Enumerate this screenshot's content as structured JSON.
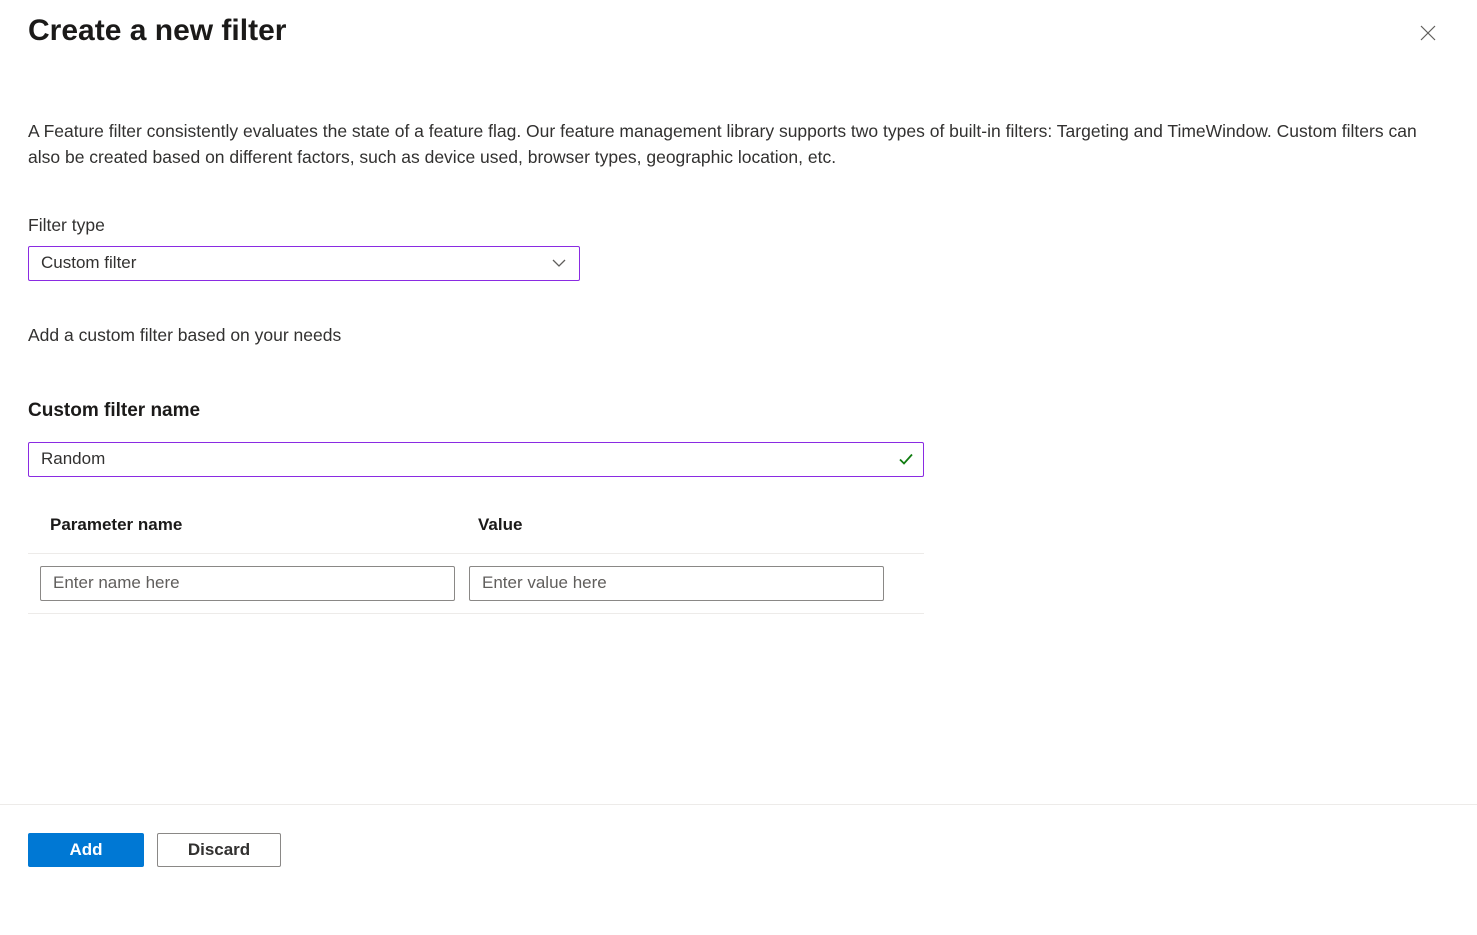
{
  "header": {
    "title": "Create a new filter"
  },
  "description": "A Feature filter consistently evaluates the state of a feature flag. Our feature management library supports two types of built-in filters: Targeting and TimeWindow. Custom filters can also be created based on different factors, such as device used, browser types, geographic location, etc.",
  "filter_type": {
    "label": "Filter type",
    "selected": "Custom filter"
  },
  "helper_text": "Add a custom filter based on your needs",
  "custom_name": {
    "label": "Custom filter name",
    "value": "Random"
  },
  "params": {
    "header_name": "Parameter name",
    "header_value": "Value",
    "rows": [
      {
        "name": "",
        "name_placeholder": "Enter name here",
        "value": "",
        "value_placeholder": "Enter value here"
      }
    ]
  },
  "footer": {
    "add_label": "Add",
    "discard_label": "Discard"
  }
}
